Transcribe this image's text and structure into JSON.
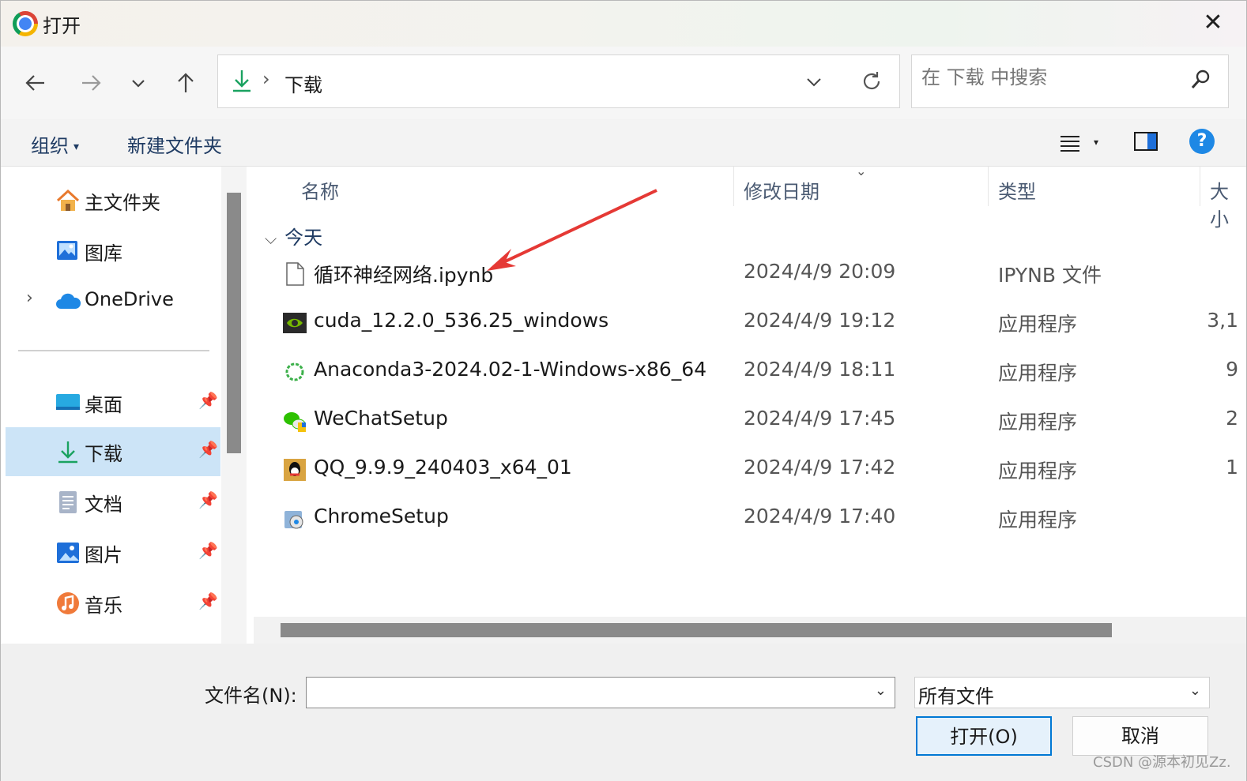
{
  "window": {
    "title": "打开",
    "close_symbol": "✕"
  },
  "nav": {
    "back_icon": "arrow-left-icon",
    "forward_icon": "arrow-right-icon",
    "recent_icon": "chevron-down-icon",
    "up_icon": "arrow-up-icon",
    "address": {
      "location_icon": "download-icon",
      "separator": "›",
      "path": "下载"
    },
    "search_placeholder": "在 下载 中搜索"
  },
  "commands": {
    "organize": "组织",
    "new_folder": "新建文件夹"
  },
  "sidebar": {
    "items": [
      {
        "label": "主文件夹",
        "icon": "home-icon",
        "pinned": false
      },
      {
        "label": "图库",
        "icon": "gallery-icon",
        "pinned": false
      },
      {
        "label": "OneDrive",
        "icon": "cloud-icon",
        "pinned": false,
        "expandable": true
      },
      {
        "label": "桌面",
        "icon": "desktop-icon",
        "pinned": true
      },
      {
        "label": "下载",
        "icon": "download-icon",
        "pinned": true,
        "selected": true
      },
      {
        "label": "文档",
        "icon": "document-icon",
        "pinned": true
      },
      {
        "label": "图片",
        "icon": "pictures-icon",
        "pinned": true
      },
      {
        "label": "音乐",
        "icon": "music-icon",
        "pinned": true
      }
    ]
  },
  "list": {
    "columns": {
      "name": "名称",
      "date": "修改日期",
      "type": "类型",
      "size": "大小"
    },
    "group": "今天",
    "files": [
      {
        "name": "循环神经网络.ipynb",
        "date": "2024/4/9 20:09",
        "type": "IPYNB 文件",
        "size": "",
        "icon": "blank-file-icon"
      },
      {
        "name": "cuda_12.2.0_536.25_windows",
        "date": "2024/4/9 19:12",
        "type": "应用程序",
        "size": "3,1",
        "icon": "nvidia-icon"
      },
      {
        "name": "Anaconda3-2024.02-1-Windows-x86_64",
        "date": "2024/4/9 18:11",
        "type": "应用程序",
        "size": "9",
        "icon": "anaconda-icon"
      },
      {
        "name": "WeChatSetup",
        "date": "2024/4/9 17:45",
        "type": "应用程序",
        "size": "2",
        "icon": "wechat-icon"
      },
      {
        "name": "QQ_9.9.9_240403_x64_01",
        "date": "2024/4/9 17:42",
        "type": "应用程序",
        "size": "1",
        "icon": "qq-icon"
      },
      {
        "name": "ChromeSetup",
        "date": "2024/4/9 17:40",
        "type": "应用程序",
        "size": "",
        "icon": "installer-icon"
      }
    ]
  },
  "footer": {
    "filename_label": "文件名(N):",
    "filename_value": "",
    "filetype": "所有文件",
    "open_button": "打开(O)",
    "cancel_button": "取消"
  },
  "watermark": "CSDN @源本初见Zz.",
  "colors": {
    "accent": "#0078d4",
    "selected_bg": "#cce4f7",
    "annotation_arrow": "#e53935"
  }
}
